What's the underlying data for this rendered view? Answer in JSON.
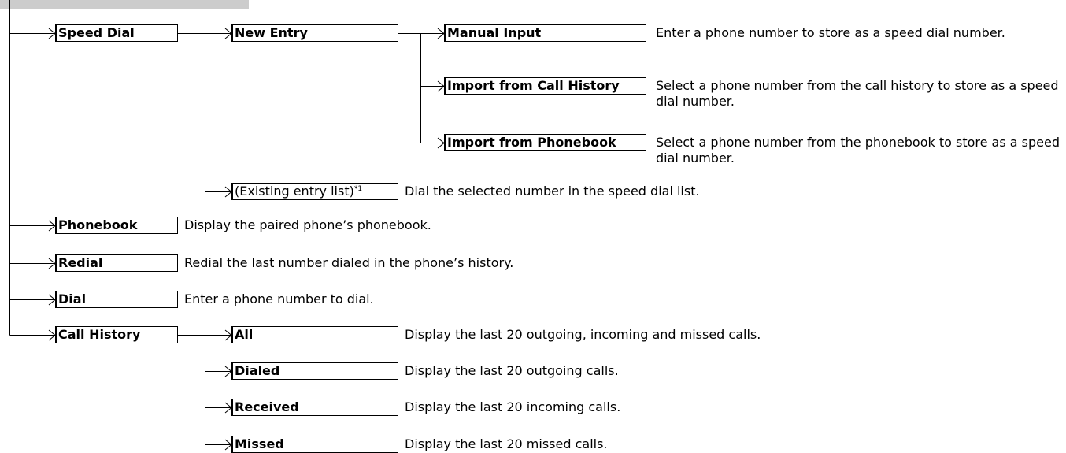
{
  "speed_dial": {
    "label": "Speed Dial",
    "new_entry": {
      "label": "New Entry",
      "manual_input": {
        "label": "Manual Input",
        "desc": "Enter a phone number to store as a speed dial number."
      },
      "import_call_history": {
        "label": "Import from Call History",
        "desc": "Select a phone number from the call history to store as a speed dial number."
      },
      "import_phonebook": {
        "label": "Import from Phonebook",
        "desc": "Select a phone number from the phonebook to store as a speed dial number."
      }
    },
    "existing_entry": {
      "label": "(Existing entry list)",
      "note_mark": "*1",
      "desc": "Dial the selected number in the speed dial list."
    }
  },
  "phonebook": {
    "label": "Phonebook",
    "desc": "Display the paired phone’s phonebook."
  },
  "redial": {
    "label": "Redial",
    "desc": "Redial the last number dialed in the phone’s history."
  },
  "dial": {
    "label": "Dial",
    "desc": "Enter a phone number to dial."
  },
  "call_history": {
    "label": "Call History",
    "all": {
      "label": "All",
      "desc": "Display the last 20 outgoing, incoming and missed calls."
    },
    "dialed": {
      "label": "Dialed",
      "desc": "Display the last 20 outgoing calls."
    },
    "received": {
      "label": "Received",
      "desc": "Display the last 20 incoming calls."
    },
    "missed": {
      "label": "Missed",
      "desc": "Display the last 20 missed calls."
    }
  }
}
